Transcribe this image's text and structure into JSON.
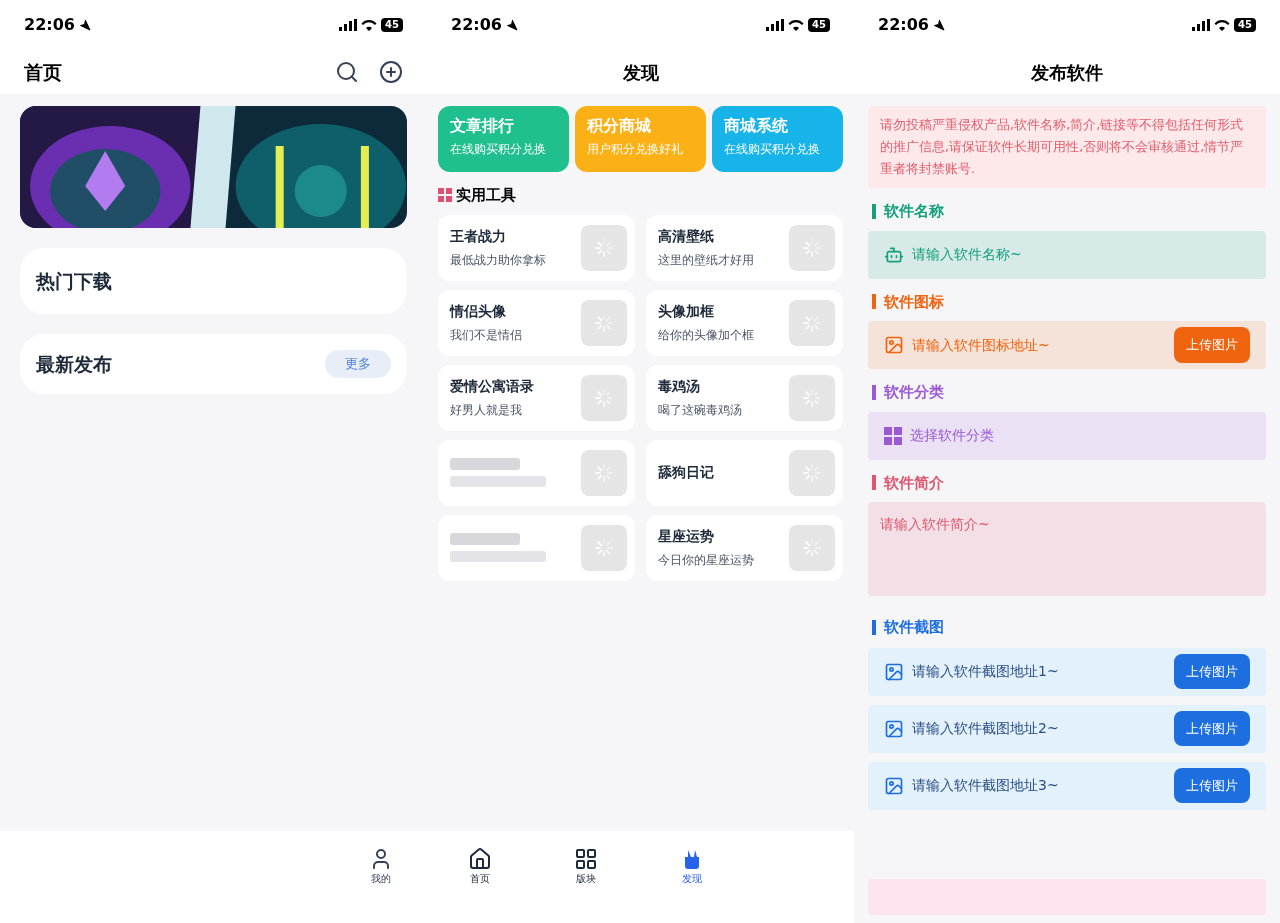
{
  "home": {
    "status": {
      "time": "22:06",
      "battery": "45"
    },
    "title": "首页",
    "sections": [
      {
        "title": "热门下载"
      },
      {
        "title": "最新发布",
        "more": "更多"
      }
    ],
    "tabbar": [
      {
        "label": "我的",
        "selected": false
      }
    ]
  },
  "discover": {
    "status": {
      "time": "22:06",
      "battery": "45"
    },
    "title": "发现",
    "banners": [
      {
        "title": "文章排行",
        "subtitle": "在线购买积分兑换",
        "color": "#1fc08e"
      },
      {
        "title": "积分商城",
        "subtitle": "用户积分兑换好礼",
        "color": "#fbb116"
      },
      {
        "title": "商城系统",
        "subtitle": "在线购买积分兑换",
        "color": "#16b4e8"
      }
    ],
    "tools_title": "实用工具",
    "tools": [
      {
        "title": "王者战力",
        "subtitle": "最低战力助你拿标"
      },
      {
        "title": "高清壁纸",
        "subtitle": "这里的壁纸才好用"
      },
      {
        "title": "情侣头像",
        "subtitle": "我们不是情侣"
      },
      {
        "title": "头像加框",
        "subtitle": "给你的头像加个框"
      },
      {
        "title": "爱情公寓语录",
        "subtitle": "好男人就是我"
      },
      {
        "title": "毒鸡汤",
        "subtitle": "喝了这碗毒鸡汤"
      },
      {
        "kind": "blurred"
      },
      {
        "title": "舔狗日记"
      },
      {
        "kind": "blurred"
      },
      {
        "title": "星座运势",
        "subtitle": "今日你的星座运势"
      }
    ],
    "tabbar": [
      {
        "label": "首页",
        "selected": false
      },
      {
        "label": "版块",
        "selected": false
      },
      {
        "label": "发现",
        "selected": true
      }
    ]
  },
  "publish": {
    "status": {
      "time": "22:06",
      "battery": "45"
    },
    "title": "发布软件",
    "notice": "请勿投稿严重侵权产品,软件名称,简介,链接等不得包括任何形式的推广信息,请保证软件长期可用性,否则将不会审核通过,情节严重者将封禁账号.",
    "fields": [
      {
        "label": "软件名称",
        "kind": "input",
        "placeholder": "请输入软件名称~",
        "color": "#13a07a"
      },
      {
        "label": "软件图标",
        "kind": "upload",
        "placeholder": "请输入软件图标地址~",
        "button": "上传图片",
        "color": "#f0640f"
      },
      {
        "label": "软件分类",
        "kind": "select",
        "placeholder": "选择软件分类",
        "color": "#9b59d6"
      },
      {
        "label": "软件简介",
        "kind": "textarea",
        "placeholder": "请输入软件简介~",
        "color": "#e0566f"
      }
    ],
    "screenshots_label": "软件截图",
    "screenshots": [
      {
        "placeholder": "请输入软件截图地址1~",
        "button": "上传图片"
      },
      {
        "placeholder": "请输入软件截图地址2~",
        "button": "上传图片"
      },
      {
        "placeholder": "请输入软件截图地址3~",
        "button": "上传图片"
      }
    ]
  }
}
